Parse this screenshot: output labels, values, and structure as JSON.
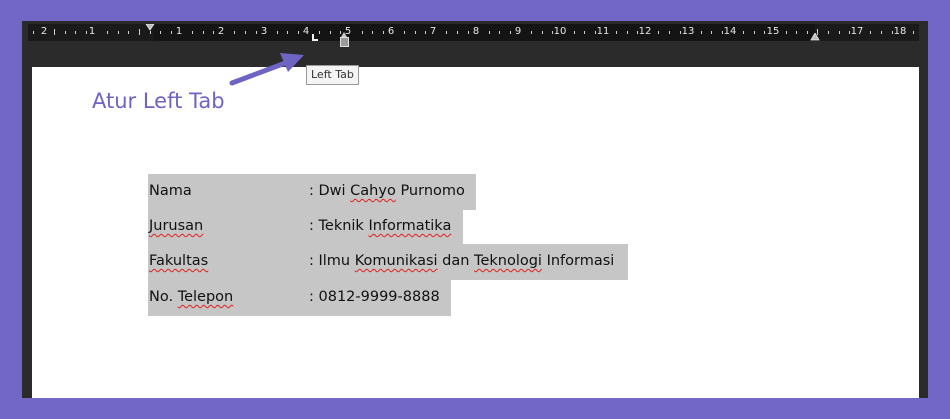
{
  "ruler": {
    "numbers": [
      "2",
      "1",
      "1",
      "2",
      "3",
      "4",
      "5",
      "6",
      "7",
      "8",
      "9",
      "10",
      "11",
      "12",
      "13",
      "14",
      "15",
      "17",
      "18"
    ]
  },
  "tooltip": {
    "text": "Left Tab"
  },
  "annotation": {
    "text": "Atur Left Tab",
    "color": "#6e64c4"
  },
  "form": {
    "rows": [
      {
        "label": "Nama",
        "value": ": Dwi Cahyo Purnomo"
      },
      {
        "label": "Jurusan",
        "value": ": Teknik Informatika"
      },
      {
        "label": "Fakultas",
        "value": ": Ilmu Komunikasi dan Teknologi Informasi"
      },
      {
        "label": "No. Telepon",
        "value": ":  0812-9999-8888"
      }
    ]
  },
  "colors": {
    "frame": "#7267c6",
    "selection": "#c6c6c6",
    "spellcheck": "#e02020"
  }
}
